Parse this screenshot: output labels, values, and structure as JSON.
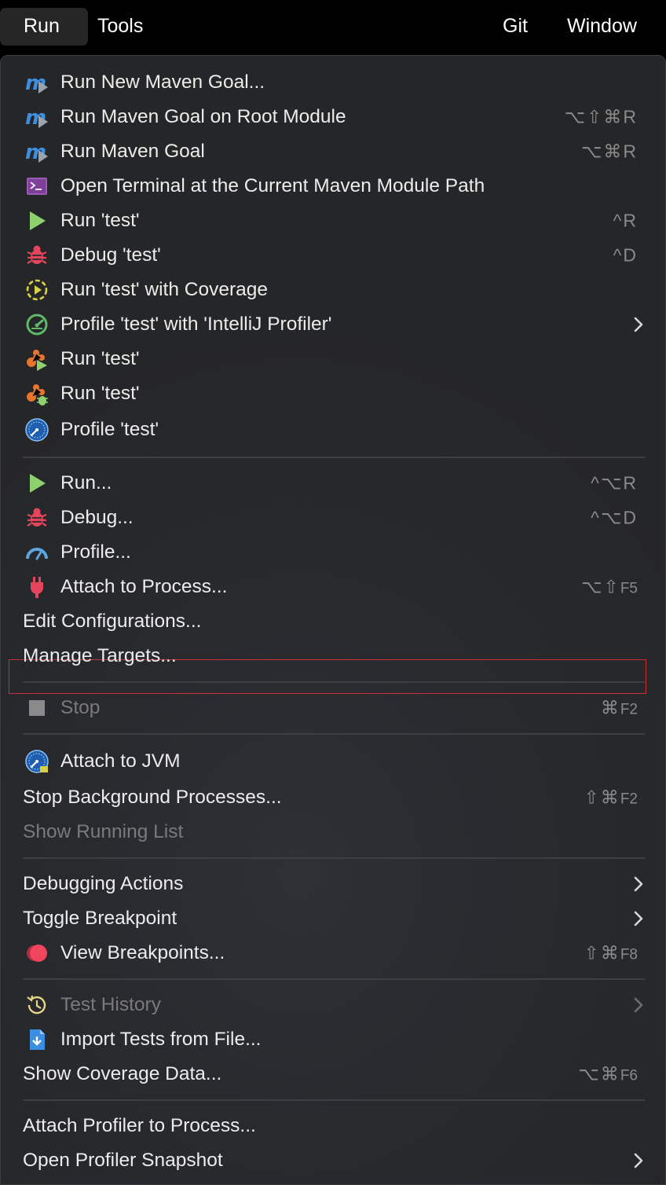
{
  "menubar": {
    "run": "Run",
    "tools": "Tools",
    "git": "Git",
    "window": "Window"
  },
  "menu": {
    "items": [
      {
        "label": "Run New Maven Goal...",
        "icon": "maven-run-icon"
      },
      {
        "label": "Run Maven Goal on Root Module",
        "icon": "maven-run-icon",
        "shortcut": "⌥⇧⌘R"
      },
      {
        "label": "Run Maven Goal",
        "icon": "maven-run-icon",
        "shortcut": "⌥⌘R"
      },
      {
        "label": "Open Terminal at the Current Maven Module Path",
        "icon": "terminal-icon"
      },
      {
        "label": "Run 'test'",
        "icon": "play-icon",
        "shortcut": "^R"
      },
      {
        "label": "Debug 'test'",
        "icon": "bug-icon",
        "shortcut": "^D"
      },
      {
        "label": "Run 'test' with Coverage",
        "icon": "coverage-icon"
      },
      {
        "label": "Profile 'test' with 'IntelliJ Profiler'",
        "icon": "profiler-icon",
        "submenu": true
      },
      {
        "label": "Run 'test'",
        "icon": "run-bundle-icon"
      },
      {
        "label": "Run 'test'",
        "icon": "debug-bundle-icon"
      },
      {
        "label": "Profile 'test'",
        "icon": "jvm-profile-icon"
      },
      {
        "label": "Run...",
        "icon": "play-icon",
        "shortcut": "^⌥R"
      },
      {
        "label": "Debug...",
        "icon": "bug-icon",
        "shortcut": "^⌥D"
      },
      {
        "label": "Profile...",
        "icon": "gauge-icon"
      },
      {
        "label": "Attach to Process...",
        "icon": "plug-icon",
        "shortcut": "⌥⇧",
        "shortcut_key": "F5"
      },
      {
        "label": "Edit Configurations...",
        "selected": true
      },
      {
        "label": "Manage Targets..."
      },
      {
        "label": "Stop",
        "icon": "stop-icon",
        "shortcut": "⌘",
        "shortcut_key": "F2",
        "disabled": true
      },
      {
        "label": "Attach to JVM",
        "icon": "jvm-attach-icon"
      },
      {
        "label": "Stop Background Processes...",
        "shortcut": "⇧⌘",
        "shortcut_key": "F2"
      },
      {
        "label": "Show Running List",
        "disabled": true
      },
      {
        "label": "Debugging Actions",
        "submenu": true
      },
      {
        "label": "Toggle Breakpoint",
        "submenu": true
      },
      {
        "label": "View Breakpoints...",
        "icon": "breakpoints-icon",
        "shortcut": "⇧⌘",
        "shortcut_key": "F8"
      },
      {
        "label": "Test History",
        "icon": "history-icon",
        "submenu": true,
        "disabled": true
      },
      {
        "label": "Import Tests from File...",
        "icon": "import-tests-icon"
      },
      {
        "label": "Show Coverage Data...",
        "shortcut": "⌥⌘",
        "shortcut_key": "F6"
      },
      {
        "label": "Attach Profiler to Process..."
      },
      {
        "label": "Open Profiler Snapshot",
        "submenu": true
      }
    ]
  },
  "colors": {
    "menu_bg": "#282a2e",
    "text": "#ececec",
    "disabled_text": "#7a7a7a",
    "shortcut": "#8a8a8a",
    "selection_border": "#c8313a",
    "run_green": "#8fd16e",
    "debug_red": "#e5455c",
    "coverage_yellow": "#d8d04a",
    "maven_blue": "#3c8fe0"
  }
}
